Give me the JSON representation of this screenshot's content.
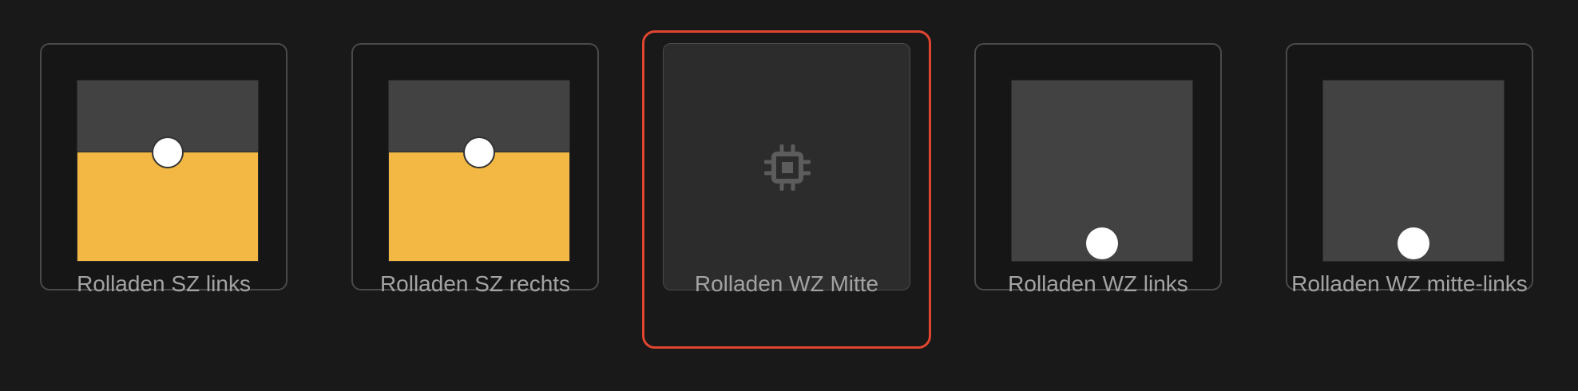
{
  "accent_color": "#e0452f",
  "shutter_fill_color": "#f3b843",
  "tiles": [
    {
      "name": "Rolladen SZ links",
      "closed_fraction": 0.6,
      "type": "shutter"
    },
    {
      "name": "Rolladen SZ rechts",
      "closed_fraction": 0.6,
      "type": "shutter"
    },
    {
      "name": "Rolladen WZ Mitte",
      "type": "device",
      "icon": "chip-icon",
      "selected": true
    },
    {
      "name": "Rolladen WZ links",
      "closed_fraction": 0.0,
      "type": "shutter"
    },
    {
      "name": "Rolladen WZ mitte-links",
      "closed_fraction": 0.0,
      "type": "shutter"
    }
  ]
}
